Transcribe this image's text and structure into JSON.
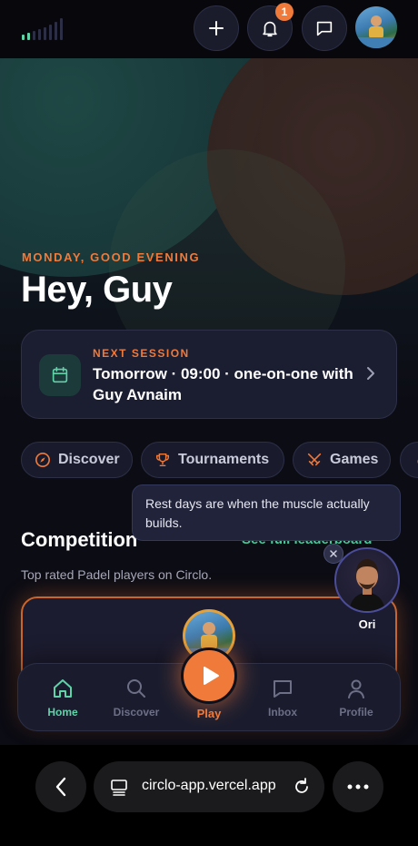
{
  "header": {
    "signal_icon": "signal-bars-icon",
    "add_icon": "plus-icon",
    "notifications_icon": "bell-icon",
    "notifications_count": "1",
    "messages_icon": "chat-icon",
    "avatar": "user-avatar"
  },
  "hero": {
    "subtitle": "MONDAY, GOOD EVENING",
    "title": "Hey, Guy"
  },
  "session": {
    "label": "NEXT SESSION",
    "text": "Tomorrow · 09:00 · one-on-one with Guy Avnaim",
    "icon": "calendar-icon"
  },
  "chips": [
    {
      "label": "Discover",
      "icon": "compass-icon"
    },
    {
      "label": "Tournaments",
      "icon": "trophy-icon"
    },
    {
      "label": "Games",
      "icon": "crossed-swords-icon"
    }
  ],
  "tooltip": {
    "text": "Rest days are when the muscle actually builds."
  },
  "competition": {
    "title": "Competition",
    "link": "See full leaderboard",
    "subtitle": "Top rated Padel players on Circlo."
  },
  "coach": {
    "name": "Ori"
  },
  "nav": {
    "items": [
      {
        "label": "Home",
        "icon": "home-icon",
        "active": true
      },
      {
        "label": "Discover",
        "icon": "search-icon",
        "active": false
      },
      {
        "label": "Play",
        "icon": "play-icon",
        "active": false
      },
      {
        "label": "Inbox",
        "icon": "inbox-icon",
        "active": false
      },
      {
        "label": "Profile",
        "icon": "profile-icon",
        "active": false
      }
    ]
  },
  "browser": {
    "url": "circlo-app.vercel.app"
  },
  "colors": {
    "accent": "#f07a3a",
    "active_green": "#5fd3a8",
    "link_green": "#49c79a",
    "card_bg": "#1b1d30"
  }
}
